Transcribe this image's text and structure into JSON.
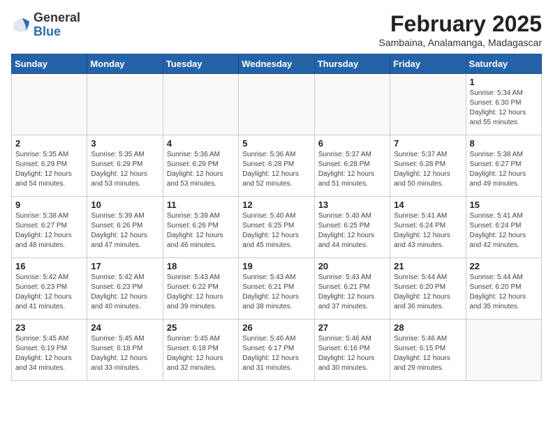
{
  "header": {
    "logo_general": "General",
    "logo_blue": "Blue",
    "month_title": "February 2025",
    "location": "Sambaina, Analamanga, Madagascar"
  },
  "days_of_week": [
    "Sunday",
    "Monday",
    "Tuesday",
    "Wednesday",
    "Thursday",
    "Friday",
    "Saturday"
  ],
  "weeks": [
    [
      {
        "day": null,
        "info": ""
      },
      {
        "day": null,
        "info": ""
      },
      {
        "day": null,
        "info": ""
      },
      {
        "day": null,
        "info": ""
      },
      {
        "day": null,
        "info": ""
      },
      {
        "day": null,
        "info": ""
      },
      {
        "day": "1",
        "info": "Sunrise: 5:34 AM\nSunset: 6:30 PM\nDaylight: 12 hours\nand 55 minutes."
      }
    ],
    [
      {
        "day": "2",
        "info": "Sunrise: 5:35 AM\nSunset: 6:29 PM\nDaylight: 12 hours\nand 54 minutes."
      },
      {
        "day": "3",
        "info": "Sunrise: 5:35 AM\nSunset: 6:29 PM\nDaylight: 12 hours\nand 53 minutes."
      },
      {
        "day": "4",
        "info": "Sunrise: 5:36 AM\nSunset: 6:29 PM\nDaylight: 12 hours\nand 53 minutes."
      },
      {
        "day": "5",
        "info": "Sunrise: 5:36 AM\nSunset: 6:28 PM\nDaylight: 12 hours\nand 52 minutes."
      },
      {
        "day": "6",
        "info": "Sunrise: 5:37 AM\nSunset: 6:28 PM\nDaylight: 12 hours\nand 51 minutes."
      },
      {
        "day": "7",
        "info": "Sunrise: 5:37 AM\nSunset: 6:28 PM\nDaylight: 12 hours\nand 50 minutes."
      },
      {
        "day": "8",
        "info": "Sunrise: 5:38 AM\nSunset: 6:27 PM\nDaylight: 12 hours\nand 49 minutes."
      }
    ],
    [
      {
        "day": "9",
        "info": "Sunrise: 5:38 AM\nSunset: 6:27 PM\nDaylight: 12 hours\nand 48 minutes."
      },
      {
        "day": "10",
        "info": "Sunrise: 5:39 AM\nSunset: 6:26 PM\nDaylight: 12 hours\nand 47 minutes."
      },
      {
        "day": "11",
        "info": "Sunrise: 5:39 AM\nSunset: 6:26 PM\nDaylight: 12 hours\nand 46 minutes."
      },
      {
        "day": "12",
        "info": "Sunrise: 5:40 AM\nSunset: 6:25 PM\nDaylight: 12 hours\nand 45 minutes."
      },
      {
        "day": "13",
        "info": "Sunrise: 5:40 AM\nSunset: 6:25 PM\nDaylight: 12 hours\nand 44 minutes."
      },
      {
        "day": "14",
        "info": "Sunrise: 5:41 AM\nSunset: 6:24 PM\nDaylight: 12 hours\nand 43 minutes."
      },
      {
        "day": "15",
        "info": "Sunrise: 5:41 AM\nSunset: 6:24 PM\nDaylight: 12 hours\nand 42 minutes."
      }
    ],
    [
      {
        "day": "16",
        "info": "Sunrise: 5:42 AM\nSunset: 6:23 PM\nDaylight: 12 hours\nand 41 minutes."
      },
      {
        "day": "17",
        "info": "Sunrise: 5:42 AM\nSunset: 6:23 PM\nDaylight: 12 hours\nand 40 minutes."
      },
      {
        "day": "18",
        "info": "Sunrise: 5:43 AM\nSunset: 6:22 PM\nDaylight: 12 hours\nand 39 minutes."
      },
      {
        "day": "19",
        "info": "Sunrise: 5:43 AM\nSunset: 6:21 PM\nDaylight: 12 hours\nand 38 minutes."
      },
      {
        "day": "20",
        "info": "Sunrise: 5:43 AM\nSunset: 6:21 PM\nDaylight: 12 hours\nand 37 minutes."
      },
      {
        "day": "21",
        "info": "Sunrise: 5:44 AM\nSunset: 6:20 PM\nDaylight: 12 hours\nand 36 minutes."
      },
      {
        "day": "22",
        "info": "Sunrise: 5:44 AM\nSunset: 6:20 PM\nDaylight: 12 hours\nand 35 minutes."
      }
    ],
    [
      {
        "day": "23",
        "info": "Sunrise: 5:45 AM\nSunset: 6:19 PM\nDaylight: 12 hours\nand 34 minutes."
      },
      {
        "day": "24",
        "info": "Sunrise: 5:45 AM\nSunset: 6:18 PM\nDaylight: 12 hours\nand 33 minutes."
      },
      {
        "day": "25",
        "info": "Sunrise: 5:45 AM\nSunset: 6:18 PM\nDaylight: 12 hours\nand 32 minutes."
      },
      {
        "day": "26",
        "info": "Sunrise: 5:46 AM\nSunset: 6:17 PM\nDaylight: 12 hours\nand 31 minutes."
      },
      {
        "day": "27",
        "info": "Sunrise: 5:46 AM\nSunset: 6:16 PM\nDaylight: 12 hours\nand 30 minutes."
      },
      {
        "day": "28",
        "info": "Sunrise: 5:46 AM\nSunset: 6:15 PM\nDaylight: 12 hours\nand 29 minutes."
      },
      {
        "day": null,
        "info": ""
      }
    ]
  ]
}
